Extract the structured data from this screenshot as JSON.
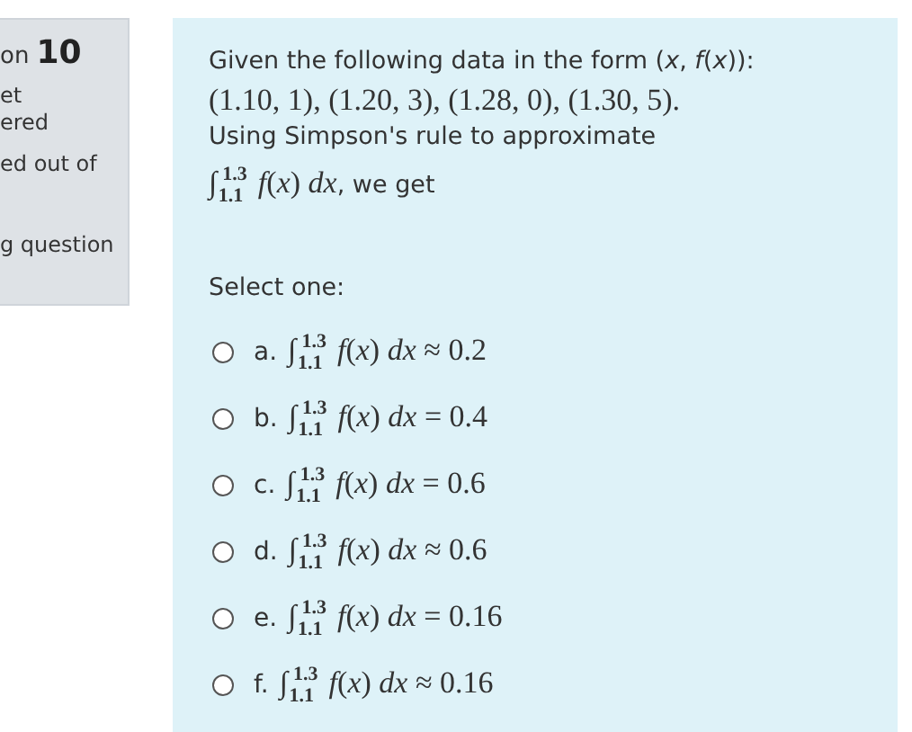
{
  "info_card": {
    "number_prefix": "on",
    "number": "10",
    "lines": [
      "et",
      "ered",
      "ed out of",
      "g question"
    ]
  },
  "question": {
    "lines": [
      {
        "kind": "text",
        "text": "Given the following data in the form (*x*, *f*(*x*)):"
      },
      {
        "kind": "math",
        "text": "(1.10, 1),  (1.20, 3),  (1.28, 0),  (1.30, 5)."
      },
      {
        "kind": "text",
        "text": "Using Simpson's rule to approximate"
      },
      {
        "kind": "mixed",
        "math": "∫$^{1.3}$$_{1.1}$ *f*(*x*) *dx*",
        "text": ", we get"
      }
    ]
  },
  "prompt": "Select one:",
  "options": [
    {
      "letter": "a.",
      "math": "∫$^{1.3}$$_{1.1}$ *f*(*x*) *dx* ≈ 0.2",
      "selected": false
    },
    {
      "letter": "b.",
      "math": "∫$^{1.3}$$_{1.1}$ *f*(*x*) *dx* = 0.4",
      "selected": false
    },
    {
      "letter": "c.",
      "math": "∫$^{1.3}$$_{1.1}$ *f*(*x*) *dx* = 0.6",
      "selected": false
    },
    {
      "letter": "d.",
      "math": "∫$^{1.3}$$_{1.1}$ *f*(*x*) *dx* ≈ 0.6",
      "selected": false
    },
    {
      "letter": "e.",
      "math": "∫$^{1.3}$$_{1.1}$ *f*(*x*) *dx* = 0.16",
      "selected": false
    },
    {
      "letter": "f.",
      "math": "∫$^{1.3}$$_{1.1}$ *f*(*x*) *dx* ≈ 0.16",
      "selected": false
    }
  ]
}
